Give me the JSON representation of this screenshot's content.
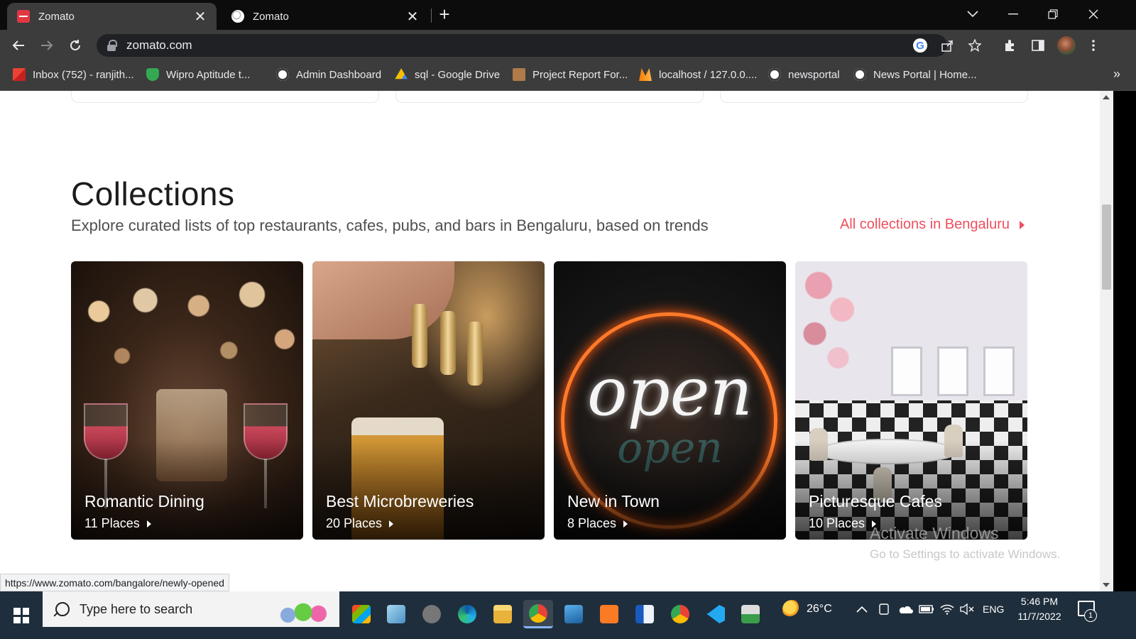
{
  "browser": {
    "tabs": [
      {
        "title": "Zomato",
        "active": true,
        "favicon": "zomato-icon"
      },
      {
        "title": "Zomato",
        "active": false,
        "favicon": "globe-icon"
      }
    ],
    "close_glyph": "✕",
    "new_tab_glyph": "+",
    "url": "zomato.com",
    "bookmarks": [
      {
        "label": "Inbox (752) - ranjith...",
        "icon": "gmail-icon"
      },
      {
        "label": "Wipro  Aptitude t...",
        "icon": "shield-icon"
      },
      {
        "label": "Admin Dashboard",
        "icon": "globe-icon"
      },
      {
        "label": "sql - Google Drive",
        "icon": "google-drive-icon"
      },
      {
        "label": "Project Report For...",
        "icon": "report-icon"
      },
      {
        "label": "localhost / 127.0.0....",
        "icon": "xampp-icon"
      },
      {
        "label": "newsportal",
        "icon": "globe-icon"
      },
      {
        "label": "News Portal | Home...",
        "icon": "globe-icon"
      }
    ],
    "bookmarks_overflow": "»",
    "status_url": "https://www.zomato.com/bangalore/newly-opened"
  },
  "page": {
    "collections_title": "Collections",
    "collections_subtitle": "Explore curated lists of top restaurants, cafes, pubs, and bars in Bengaluru, based on trends",
    "all_collections_link": "All collections in Bengaluru",
    "accent_color": "#ef4f5f",
    "cards": [
      {
        "title": "Romantic Dining",
        "count": "11 Places"
      },
      {
        "title": "Best Microbreweries",
        "count": "20 Places"
      },
      {
        "title": "New in Town",
        "count": "8 Places",
        "image_text": "open"
      },
      {
        "title": "Picturesque Cafes",
        "count": "10 Places"
      }
    ]
  },
  "watermark": {
    "line1": "Activate Windows",
    "line2": "Go to Settings to activate Windows."
  },
  "taskbar": {
    "search_placeholder": "Type here to search",
    "weather_temp": "26°C",
    "language": "ENG",
    "time": "5:46 PM",
    "date": "11/7/2022",
    "notification_count": "1"
  }
}
